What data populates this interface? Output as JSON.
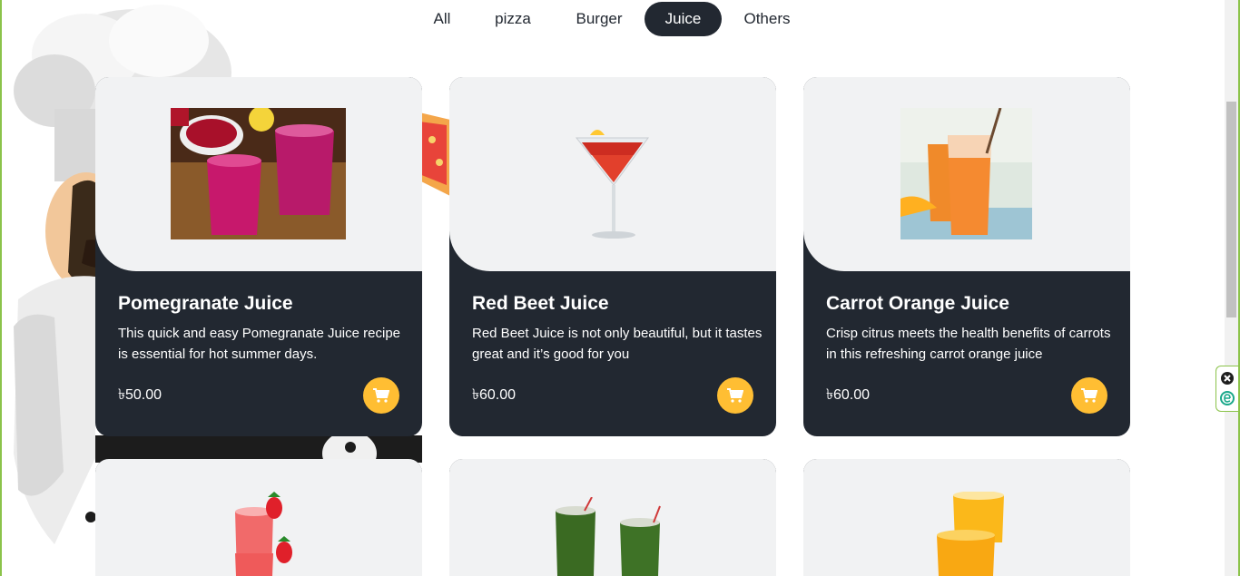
{
  "filters": {
    "items": [
      "All",
      "pizza",
      "Burger",
      "Juice",
      "Others"
    ],
    "active": "Juice"
  },
  "currency": "৳",
  "products": [
    {
      "title": "Pomegranate Juice",
      "description": "This quick and easy Pomegranate Juice recipe is essential for hot summer days.",
      "price": "৳50.00",
      "image": "pomegranate-juice-image"
    },
    {
      "title": "Red Beet Juice",
      "description": "Red Beet Juice is not only beautiful, but it tastes great and it’s good for you",
      "price": "৳60.00",
      "image": "cocktail-glass-image"
    },
    {
      "title": "Carrot Orange Juice",
      "description": "Crisp citrus meets the health benefits of carrots in this refreshing carrot orange juice",
      "price": "৳60.00",
      "image": "carrot-orange-juice-image"
    },
    {
      "image": "strawberry-juice-image"
    },
    {
      "image": "green-juice-image"
    },
    {
      "image": "orange-juice-image"
    }
  ],
  "icons": {
    "cart": "cart-icon",
    "close": "close-icon",
    "extension": "extension-icon"
  },
  "colors": {
    "dark": "#222831",
    "accent": "#ffbe33",
    "card_top": "#f1f2f3",
    "frame": "#8bc34a"
  }
}
